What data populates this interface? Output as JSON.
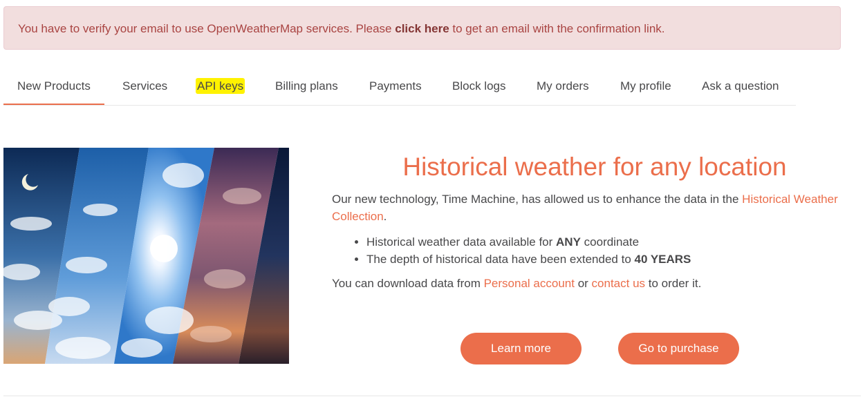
{
  "alert": {
    "text_before": "You have to verify your email to use OpenWeatherMap services. Please ",
    "link_text": "click here",
    "text_after": " to get an email with the confirmation link."
  },
  "tabs": [
    {
      "label": "New Products",
      "active": true
    },
    {
      "label": "Services"
    },
    {
      "label": "API keys",
      "highlighted": true
    },
    {
      "label": "Billing plans"
    },
    {
      "label": "Payments"
    },
    {
      "label": "Block logs"
    },
    {
      "label": "My orders"
    },
    {
      "label": "My profile"
    },
    {
      "label": "Ask a question"
    }
  ],
  "hero": {
    "title": "Historical weather for any location",
    "intro_before": "Our new technology, Time Machine, has allowed us to enhance the data in the ",
    "intro_link": "Historical Weather Collection",
    "intro_after": ".",
    "bullets": [
      {
        "before": "Historical weather data available for ",
        "bold": "ANY",
        "after": " coordinate"
      },
      {
        "before": "The depth of historical data have been extended to ",
        "bold": "40 YEARS",
        "after": ""
      }
    ],
    "download_before": "You can download data from ",
    "download_link1": "Personal account",
    "download_middle": " or ",
    "download_link2": "contact us",
    "download_after": " to order it.",
    "learn_more": "Learn more",
    "purchase": "Go to purchase"
  },
  "colors": {
    "accent": "#eb6e4b",
    "alert_bg": "#f2dede",
    "alert_text": "#a94442",
    "highlight": "#fff200"
  }
}
